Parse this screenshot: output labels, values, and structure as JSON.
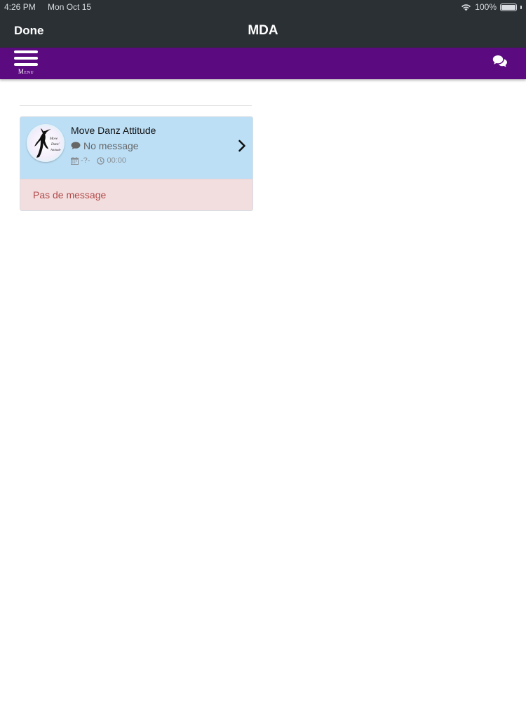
{
  "status_bar": {
    "time": "4:26 PM",
    "date": "Mon Oct 15",
    "battery": "100%",
    "battery_level": 1.0,
    "wifi_icon": "wifi-icon",
    "battery_icon": "battery-icon"
  },
  "nav_bar": {
    "done_label": "Done",
    "title": "MDA"
  },
  "app_bar": {
    "menu_label": "Menu",
    "menu_icon": "hamburger-menu-icon",
    "chat_icon": "chat-bubbles-icon",
    "color": "#5c0a80"
  },
  "conversation": {
    "name": "Move Danz Attitude",
    "last_message": "No message",
    "date": "-?-",
    "time": "00:00",
    "avatar_text": [
      "Move",
      "Danz'",
      "Attitude"
    ],
    "icons": [
      "comment-icon",
      "calendar-icon",
      "clock-icon",
      "chevron-right-icon"
    ],
    "background": "#bcdff6"
  },
  "notice": {
    "text": "Pas de message",
    "background": "#f2dede",
    "color": "#b34a4a"
  }
}
